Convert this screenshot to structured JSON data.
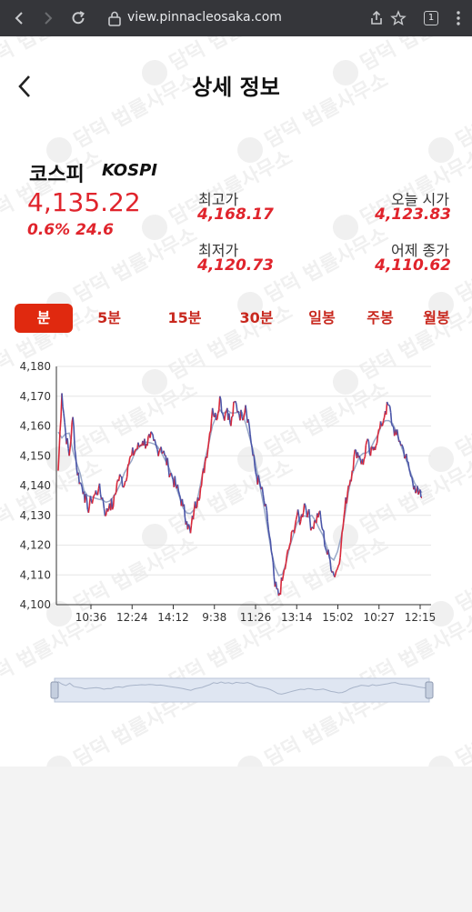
{
  "browser": {
    "url": "view.pinnacleosaka.com",
    "tab_count": "1"
  },
  "header": {
    "title": "상세 정보"
  },
  "index": {
    "name": "코스피",
    "code": "KOSPI",
    "price": "4,135.22",
    "change": "0.6% 24.6"
  },
  "stats": {
    "high_label": "최고가",
    "high_value": "4,168.17",
    "open_label": "오늘 시가",
    "open_value": "4,123.83",
    "low_label": "최저가",
    "low_value": "4,120.73",
    "prev_close_label": "어제 종가",
    "prev_close_value": "4,110.62"
  },
  "tabs": [
    "분",
    "5분",
    "15분",
    "30분",
    "일봉",
    "주봉",
    "월봉"
  ],
  "active_tab": "분",
  "watermark": "담덕 법률사무소",
  "colors": {
    "accent": "#e0242c",
    "tab_active_bg": "#e0290f",
    "series_blue": "#4a55a8",
    "series_red": "#d8283a",
    "ma_line": "#9aa9c8"
  },
  "chart_data": {
    "type": "line",
    "title": "",
    "xlabel": "",
    "ylabel": "",
    "ylim": [
      4100,
      4180
    ],
    "yticks": [
      "4,180",
      "4,170",
      "4,160",
      "4,150",
      "4,140",
      "4,130",
      "4,120",
      "4,110",
      "4,100"
    ],
    "xticks": [
      "10:36",
      "12:24",
      "14:12",
      "9:38",
      "11:26",
      "13:14",
      "15:02",
      "10:27",
      "12:15"
    ],
    "grid": true,
    "series": [
      {
        "values": [
          4145,
          4171,
          4158,
          4150,
          4163,
          4146,
          4141,
          4138,
          4132,
          4135,
          4137,
          4139,
          4136,
          4130,
          4134,
          4133,
          4141,
          4143,
          4140,
          4147,
          4150,
          4152,
          4153,
          4155,
          4154,
          4156,
          4155,
          4152,
          4153,
          4150,
          4146,
          4143,
          4140,
          4137,
          4133,
          4128,
          4124,
          4132,
          4136,
          4140,
          4148,
          4155,
          4166,
          4162,
          4170,
          4163,
          4166,
          4160,
          4168,
          4165,
          4163,
          4167,
          4160,
          4150,
          4143,
          4140,
          4135,
          4128,
          4118,
          4106,
          4103,
          4108,
          4114,
          4120,
          4125,
          4130,
          4128,
          4134,
          4131,
          4126,
          4128,
          4131,
          4125,
          4118,
          4115,
          4110,
          4112,
          4120,
          4132,
          4140,
          4145,
          4152,
          4150,
          4147,
          4155,
          4150,
          4153,
          4157,
          4160,
          4165,
          4167,
          4160,
          4157,
          4155,
          4152,
          4148,
          4143,
          4140,
          4137,
          4136
        ]
      }
    ]
  }
}
